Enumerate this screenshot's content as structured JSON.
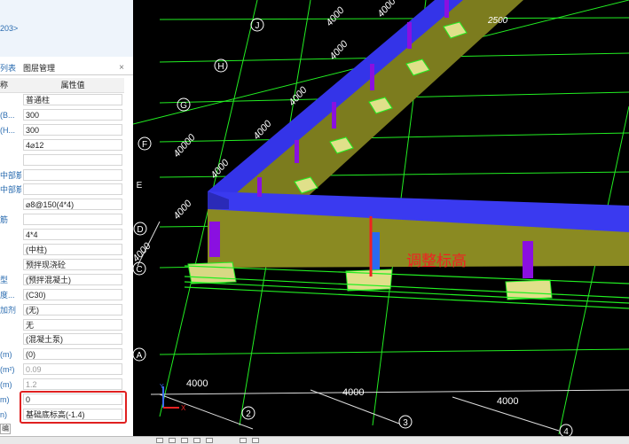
{
  "panel": {
    "breadcrumb_fragment": "203>",
    "tabs": [
      "列表",
      "图层管理"
    ],
    "close_glyph": "×",
    "columns": [
      "称",
      "属性值"
    ],
    "rows": [
      {
        "name": "",
        "value": "普通柱"
      },
      {
        "name": "(B...",
        "value": "300"
      },
      {
        "name": "(H...",
        "value": "300"
      },
      {
        "name": "",
        "value": "4⌀12"
      },
      {
        "name": "",
        "value": ""
      },
      {
        "name": "中部筋",
        "value": ""
      },
      {
        "name": "中部筋",
        "value": ""
      },
      {
        "name": "",
        "value": "⌀8@150(4*4)"
      },
      {
        "name": "筋",
        "value": ""
      },
      {
        "name": "",
        "value": "4*4"
      },
      {
        "name": "",
        "value": "(中柱)"
      },
      {
        "name": "",
        "value": "预拌现浇砼"
      },
      {
        "name": "型",
        "value": "(预拌混凝土)"
      },
      {
        "name": "度...",
        "value": "(C30)"
      },
      {
        "name": "加剂",
        "value": "(无)"
      },
      {
        "name": "",
        "value": "无"
      },
      {
        "name": "",
        "value": "(混凝土泵)"
      },
      {
        "name": "(m)",
        "value": "(0)"
      },
      {
        "name": "(m²)",
        "value": "0.09"
      },
      {
        "name": "(m)",
        "value": "1.2"
      },
      {
        "name": "m)",
        "value": "0"
      },
      {
        "name": "n)",
        "value": "基础底标高(-1.4)"
      }
    ],
    "bottom_tab": "编"
  },
  "viewport": {
    "annotation": "调整标高",
    "axis_rows": [
      "J",
      "H",
      "G",
      "F",
      "E",
      "D",
      "C",
      "A"
    ],
    "axis_cols": [
      "2",
      "3",
      "4"
    ],
    "dims_diag": [
      "4000",
      "4000",
      "4000",
      "4000",
      "40000",
      "4000",
      "4000",
      "4000"
    ],
    "dim_top": "2500",
    "dims_bottom": [
      "4000",
      "4000",
      "4000"
    ],
    "triad": {
      "x": "X",
      "y": "Y"
    }
  },
  "colors": {
    "beam_blue": "#3a3af0",
    "wall_olive": "#8a8a22",
    "column_purple": "#8a10e0",
    "footing_yellow": "#e0e08a",
    "grid_green": "#22ee22",
    "annotation_red": "#ee2222",
    "highlight_red": "#e02020"
  }
}
